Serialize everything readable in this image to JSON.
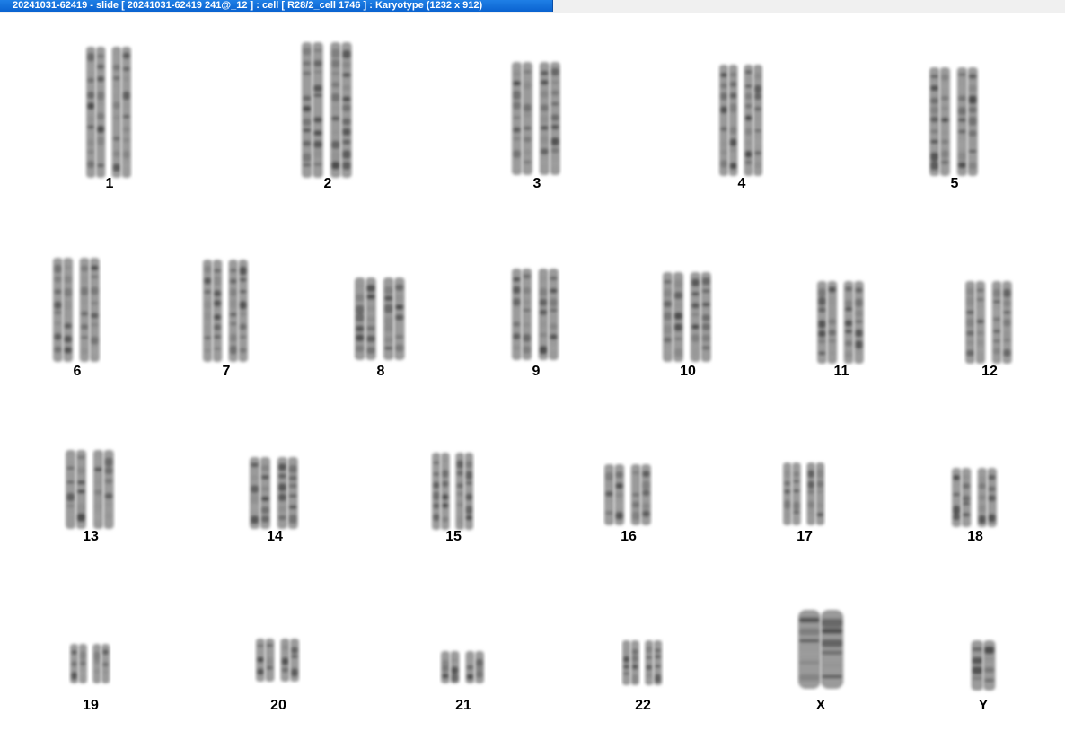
{
  "window": {
    "title": "20241031-62419 - slide [ 20241031-62419 241@_12 ] : cell [ R28/2_cell 1746 ] : Karyotype  (1232 x 912)"
  },
  "karyotype": {
    "chromosomes": [
      {
        "label": "1"
      },
      {
        "label": "2"
      },
      {
        "label": "3"
      },
      {
        "label": "4"
      },
      {
        "label": "5"
      },
      {
        "label": "6"
      },
      {
        "label": "7"
      },
      {
        "label": "8"
      },
      {
        "label": "9"
      },
      {
        "label": "10"
      },
      {
        "label": "11"
      },
      {
        "label": "12"
      },
      {
        "label": "13"
      },
      {
        "label": "14"
      },
      {
        "label": "15"
      },
      {
        "label": "16"
      },
      {
        "label": "17"
      },
      {
        "label": "18"
      },
      {
        "label": "19"
      },
      {
        "label": "20"
      },
      {
        "label": "21"
      },
      {
        "label": "22"
      },
      {
        "label": "X"
      },
      {
        "label": "Y"
      }
    ]
  }
}
